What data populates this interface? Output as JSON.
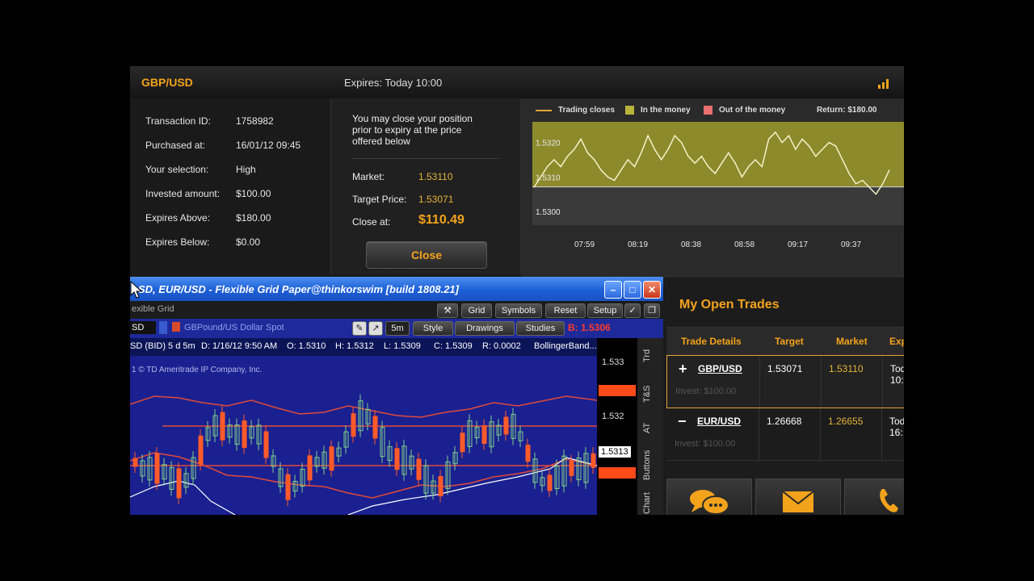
{
  "header": {
    "asset": "GBP/USD",
    "expires": "Expires:  Today 10:00"
  },
  "details": [
    {
      "label": "Transaction ID:",
      "value": "1758982"
    },
    {
      "label": "Purchased at:",
      "value": "16/01/12 09:45"
    },
    {
      "label": "Your selection:",
      "value": "High"
    },
    {
      "label": "Invested amount:",
      "value": "$100.00"
    },
    {
      "label": "Expires Above:",
      "value": "$180.00"
    },
    {
      "label": "Expires Below:",
      "value": "$0.00"
    }
  ],
  "close_panel": {
    "message": "You may close your position prior to expiry at the price offered below",
    "market_label": "Market:",
    "market_value": "1.53110",
    "target_label": "Target Price:",
    "target_value": "1.53071",
    "close_at_label": "Close at:",
    "close_at_value": "$110.49",
    "close_button": "Close"
  },
  "chart_legend": {
    "trading_closes": "Trading closes",
    "in_money": "In the money",
    "out_money": "Out of the money",
    "return": "Return: $180.00"
  },
  "chart_data": {
    "type": "line",
    "title": "",
    "x_ticks": [
      "07:59",
      "08:19",
      "08:38",
      "08:58",
      "09:17",
      "09:37"
    ],
    "y_ticks": [
      "1.5320",
      "1.5310",
      "1.5300"
    ],
    "ylim": [
      1.5296,
      1.5326
    ],
    "target": 1.53071,
    "series": [
      {
        "values": [
          1.5307,
          1.531,
          1.5313,
          1.5315,
          1.5313,
          1.5316,
          1.5318,
          1.5321,
          1.5317,
          1.5315,
          1.5312,
          1.531,
          1.5309,
          1.5312,
          1.5315,
          1.5313,
          1.5317,
          1.5322,
          1.5318,
          1.5315,
          1.5318,
          1.5322,
          1.532,
          1.5316,
          1.5314,
          1.5316,
          1.5313,
          1.5311,
          1.5314,
          1.5317,
          1.5314,
          1.531,
          1.5313,
          1.5315,
          1.5313,
          1.5321,
          1.5323,
          1.532,
          1.5322,
          1.5318,
          1.5321,
          1.5319,
          1.5316,
          1.5318,
          1.532,
          1.5319,
          1.5315,
          1.5311,
          1.5308,
          1.5309,
          1.5307,
          1.5305,
          1.5308,
          1.5312
        ]
      }
    ]
  },
  "trades": {
    "title": "My Open Trades",
    "headers": [
      "Trade Details",
      "Target",
      "Market",
      "Exp"
    ],
    "rows": [
      {
        "sign": "+",
        "symbol": "GBP/USD",
        "invest": "Invest: $100.00",
        "target": "1.53071",
        "market": "1.53110",
        "expiry_1": "Tod",
        "expiry_2": "10:"
      },
      {
        "sign": "−",
        "symbol": "EUR/USD",
        "invest": "Invest: $100.00",
        "target": "1.26668",
        "market": "1.26655",
        "expiry_1": "Tod",
        "expiry_2": "16:"
      }
    ]
  },
  "tos": {
    "title": "SD, EUR/USD - Flexible Grid Paper@thinkorswim [build 1808.21]",
    "grid_label": "exible Grid",
    "toolbar": [
      "Grid",
      "Symbols",
      "Reset",
      "Setup"
    ],
    "symbol_box": "SD",
    "symbol_desc": "GBPound/US Dollar Spot",
    "timeframe": "5m",
    "style": "Style",
    "drawings": "Drawings",
    "studies": "Studies",
    "bid_value": "B: 1.5306",
    "info_line": [
      "SD (BID) 5 d 5m",
      "D: 1/16/12 9:50 AM",
      "O: 1.5310",
      "H: 1.5312",
      "L: 1.5309",
      "C: 1.5309",
      "R: 0.0002",
      "BollingerBand..."
    ],
    "copyright": "1 © TD Ameritrade IP Company, Inc.",
    "price_labels": [
      "1.533",
      "1.532",
      "1.5313"
    ],
    "side_tabs": [
      "Trd",
      "T&S",
      "AT",
      "Buttons",
      "Chart"
    ]
  }
}
